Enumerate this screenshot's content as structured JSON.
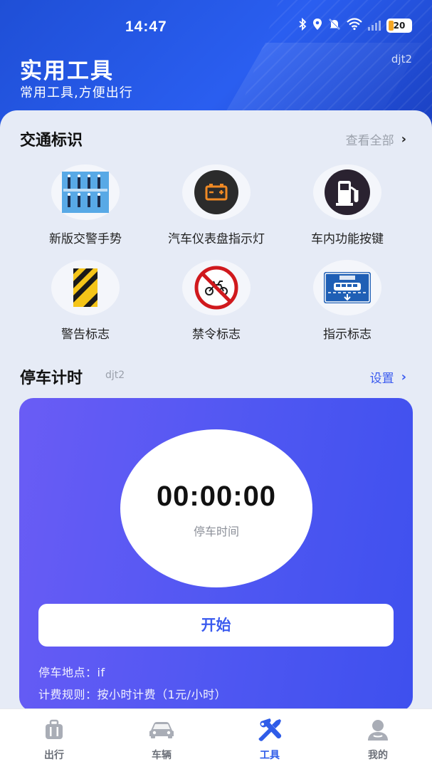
{
  "status_bar": {
    "time": "14:47",
    "battery": "20"
  },
  "header": {
    "title": "实用工具",
    "subtitle": "常用工具,方便出行",
    "user": "djt2"
  },
  "traffic_signs": {
    "title": "交通标识",
    "view_all": "查看全部",
    "items": [
      {
        "label": "新版交警手势",
        "icon": "traffic-police-gesture-icon"
      },
      {
        "label": "汽车仪表盘指示灯",
        "icon": "battery-warning-light-icon"
      },
      {
        "label": "车内功能按键",
        "icon": "fuel-pump-icon"
      },
      {
        "label": "警告标志",
        "icon": "warning-stripe-sign-icon"
      },
      {
        "label": "禁令标志",
        "icon": "no-motorbike-sign-icon"
      },
      {
        "label": "指示标志",
        "icon": "bus-lane-sign-icon"
      }
    ]
  },
  "parking_timer": {
    "title": "停车计时",
    "user": "djt2",
    "settings": "设置",
    "time": "00:00:00",
    "time_label": "停车时间",
    "start": "开始",
    "location": "停车地点：if",
    "rule": "计费规则：按小时计费（1元/小时）"
  },
  "bottom_nav": {
    "items": [
      {
        "label": "出行",
        "icon": "luggage-icon",
        "active": false
      },
      {
        "label": "车辆",
        "icon": "car-icon",
        "active": false
      },
      {
        "label": "工具",
        "icon": "tools-icon",
        "active": true
      },
      {
        "label": "我的",
        "icon": "user-icon",
        "active": false
      }
    ]
  },
  "colors": {
    "header_blue": "#2a5ef0",
    "accent_blue": "#3b5bef",
    "timer_gradient_start": "#6a5cf5",
    "timer_gradient_end": "#3e50ee"
  }
}
